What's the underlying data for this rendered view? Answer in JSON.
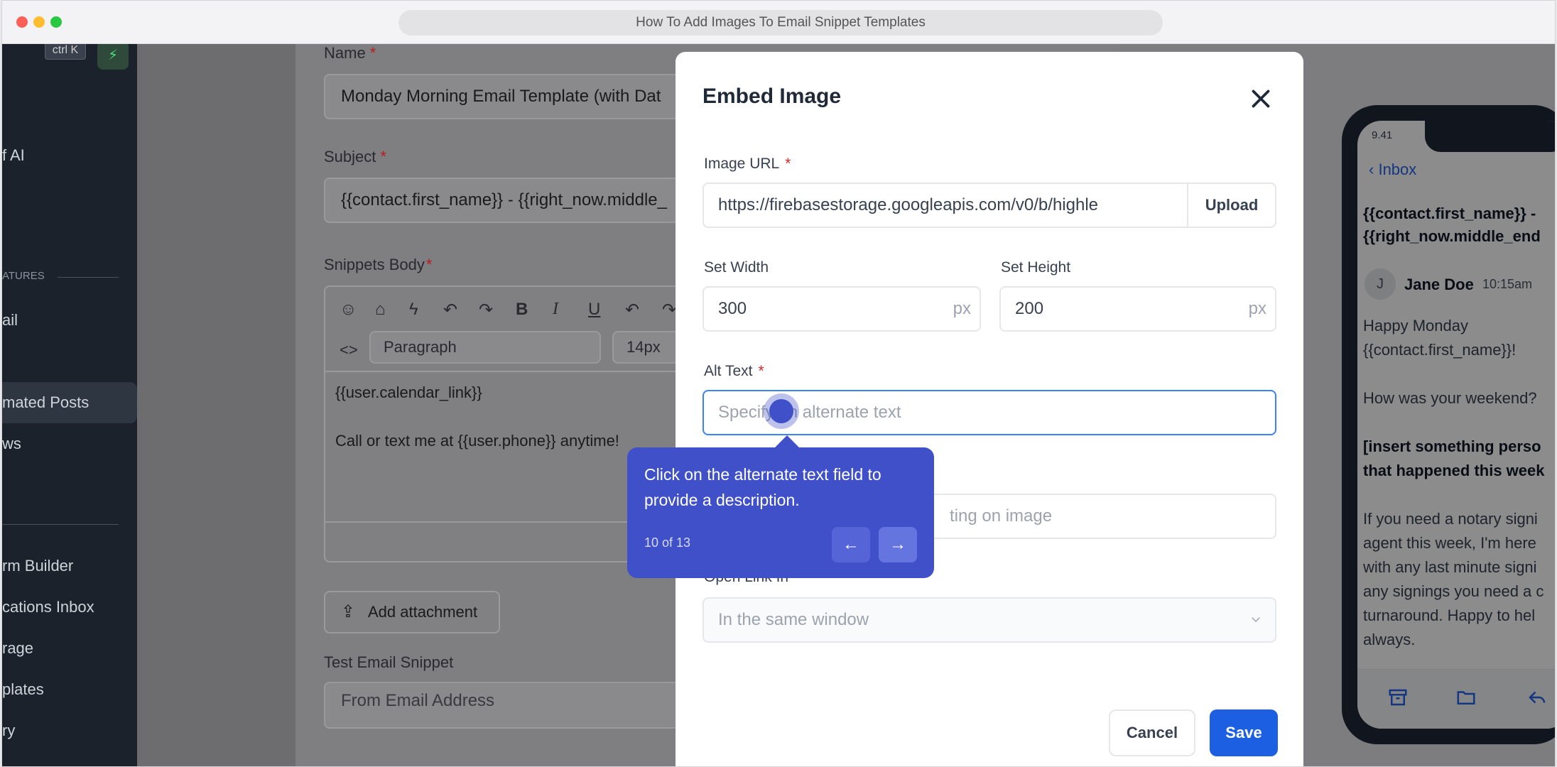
{
  "window": {
    "title": "How To Add Images To Email Snippet Templates",
    "colors": {
      "close": "#ff5f57",
      "minimize": "#febc2e",
      "zoom": "#28c840"
    }
  },
  "sidebar": {
    "shortcut": "ctrl K",
    "items": [
      {
        "label": "f AI"
      },
      {
        "label": "ATURES"
      },
      {
        "label": "ail"
      },
      {
        "label": "mated Posts"
      },
      {
        "label": "ws"
      },
      {
        "label": "rm Builder"
      },
      {
        "label": "cations Inbox"
      },
      {
        "label": "rage"
      },
      {
        "label": "plates"
      },
      {
        "label": "ry"
      }
    ]
  },
  "form": {
    "name_label": "Name",
    "name_value": "Monday Morning Email Template (with Dat",
    "subject_label": "Subject",
    "subject_value": "{{contact.first_name}} - {{right_now.middle_",
    "body_label": "Snippets Body",
    "paragraph_select": "Paragraph",
    "font_size": "14px",
    "body_line1": "{{user.calendar_link}}",
    "body_line2": "Call or text me at {{user.phone}} anytime!",
    "attach_label": "Add attachment",
    "test_label": "Test Email Snippet",
    "from_placeholder": "From Email Address"
  },
  "modal": {
    "title": "Embed Image",
    "image_url_label": "Image URL",
    "image_url_value": "https://firebasestorage.googleapis.com/v0/b/highle",
    "upload_label": "Upload",
    "width_label": "Set Width",
    "width_value": "300",
    "height_label": "Set Height",
    "height_value": "200",
    "unit": "px",
    "alt_label": "Alt Text",
    "alt_placeholder": "Specify an alternate text",
    "link_placeholder_tail": "ting on image",
    "open_link_label": "Open Link In",
    "open_link_value": "In the same window",
    "cancel_label": "Cancel",
    "save_label": "Save",
    "accent": "#1d5fe3"
  },
  "tooltip": {
    "text": "Click on the alternate text field to provide a description.",
    "step": "10 of 13",
    "color": "#3f50c9"
  },
  "phone": {
    "time": "9.41",
    "back_label": "Inbox",
    "subject_line1": "{{contact.first_name}} -",
    "subject_line2": "{{right_now.middle_end",
    "avatar_letter": "J",
    "sender": "Jane Doe",
    "sent_time": "10:15am",
    "body": [
      "Happy Monday",
      "{{contact.first_name}}!",
      "How was your weekend?",
      "[insert something perso",
      "that happened this week",
      "If you need a notary signi",
      "agent this week, I'm here",
      "with any last minute signi",
      "any signings you need a c",
      "turnaround. Happy to hel",
      "always."
    ]
  }
}
